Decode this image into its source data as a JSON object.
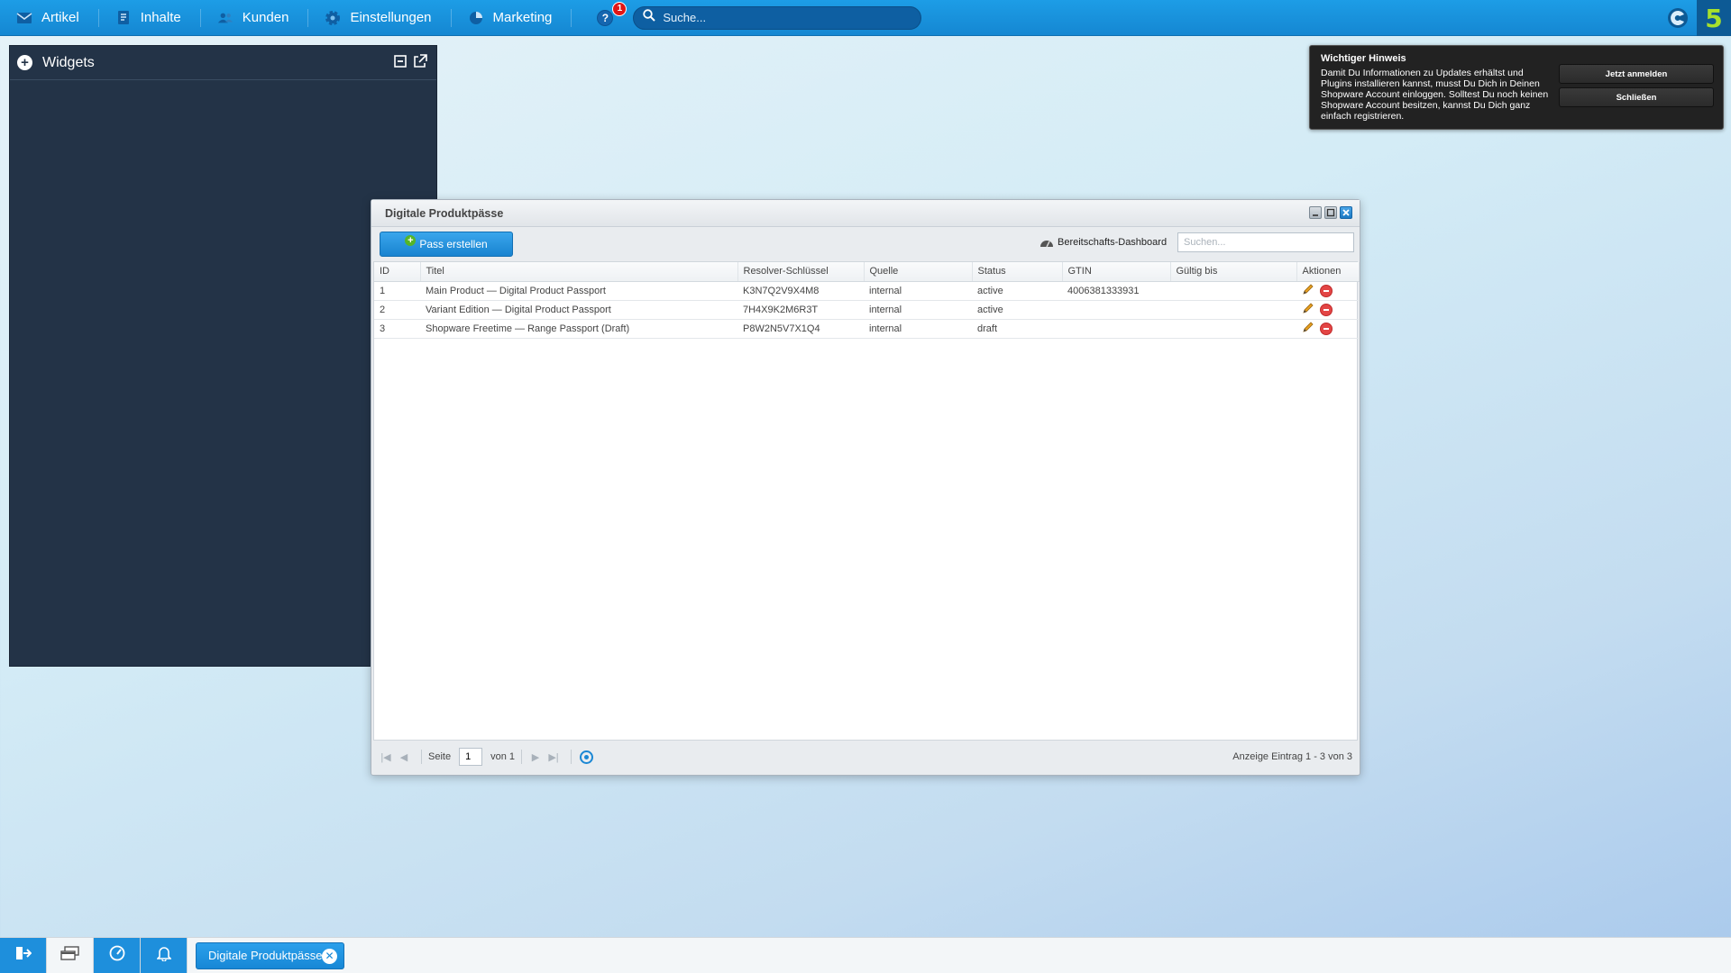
{
  "topbar": {
    "nav": [
      {
        "label": "Artikel",
        "icon": "mail-icon"
      },
      {
        "label": "Inhalte",
        "icon": "document-icon"
      },
      {
        "label": "Kunden",
        "icon": "users-icon"
      },
      {
        "label": "Einstellungen",
        "icon": "gear-icon"
      },
      {
        "label": "Marketing",
        "icon": "pie-chart-icon"
      }
    ],
    "help_label": "?",
    "help_badge": "1",
    "search_placeholder": "Suche...",
    "logo_text": "5"
  },
  "widgets": {
    "title": "Widgets"
  },
  "notice": {
    "title": "Wichtiger Hinweis",
    "text": "Damit Du Informationen zu Updates erhältst und Plugins installieren kannst, musst Du Dich in Deinen Shopware Account einloggen. Solltest Du noch keinen Shopware Account besitzen, kannst Du Dich ganz einfach registrieren.",
    "login_button": "Jetzt anmelden",
    "close_button": "Schließen"
  },
  "window": {
    "title": "Digitale Produktpässe",
    "create_button": "Pass erstellen",
    "dashboard_link": "Bereitschafts-Dashboard",
    "search_placeholder": "Suchen...",
    "columns": [
      "ID",
      "Titel",
      "Resolver-Schlüssel",
      "Quelle",
      "Status",
      "GTIN",
      "Gültig bis",
      "Aktionen"
    ],
    "rows": [
      {
        "id": "1",
        "title": "Main Product — Digital Product Passport",
        "key": "K3N7Q2V9X4M8",
        "source": "internal",
        "status": "active",
        "gtin": "4006381333931",
        "valid": ""
      },
      {
        "id": "2",
        "title": "Variant Edition — Digital Product Passport",
        "key": "7H4X9K2M6R3T",
        "source": "internal",
        "status": "active",
        "gtin": "",
        "valid": ""
      },
      {
        "id": "3",
        "title": "Shopware Freetime — Range Passport (Draft)",
        "key": "P8W2N5V7X1Q4",
        "source": "internal",
        "status": "draft",
        "gtin": "",
        "valid": ""
      }
    ],
    "pager": {
      "page_label": "Seite",
      "page_value": "1",
      "of_label": "von 1",
      "info": "Anzeige Eintrag 1 - 3 von 3"
    }
  },
  "taskbar": {
    "task_label": "Digitale Produktpässe"
  },
  "colors": {
    "accent": "#1d9de6",
    "panel": "#233347",
    "delete": "#e34545"
  }
}
